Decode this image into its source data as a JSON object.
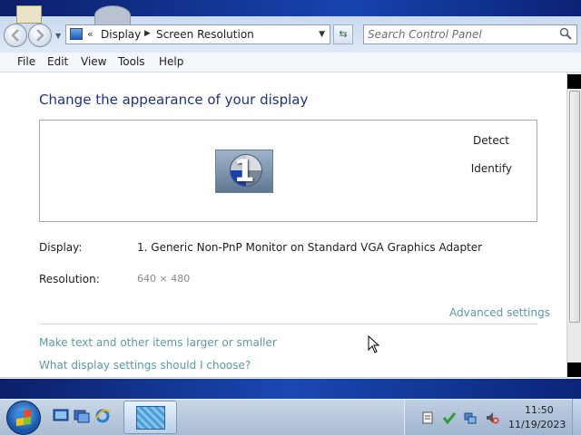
{
  "window": {
    "breadcrumbs": [
      "Display",
      "Screen Resolution"
    ],
    "address_chevrons": "«",
    "search_placeholder": "Search Control Panel"
  },
  "menu": [
    "File",
    "Edit",
    "View",
    "Tools",
    "Help"
  ],
  "main": {
    "title": "Change the appearance of your display",
    "monitor_number": "1",
    "detect_label": "Detect",
    "identify_label": "Identify",
    "display_label": "Display:",
    "display_value": "1. Generic Non-PnP Monitor on Standard VGA Graphics Adapter",
    "resolution_label": "Resolution:",
    "resolution_value": "640 × 480",
    "advanced_link": "Advanced settings",
    "links": [
      "Make text and other items larger or smaller",
      "What display settings should I choose?"
    ]
  },
  "taskbar": {
    "time": "11:50",
    "date": "11/19/2023"
  },
  "icons": {
    "back": "back-arrow-icon",
    "forward": "forward-arrow-icon",
    "search": "search-icon",
    "refresh": "refresh-icon",
    "start": "windows-start-icon"
  },
  "colors": {
    "title": "#1e3287",
    "link": "#5a9aa8",
    "muted_value": "#8a8a8a"
  }
}
